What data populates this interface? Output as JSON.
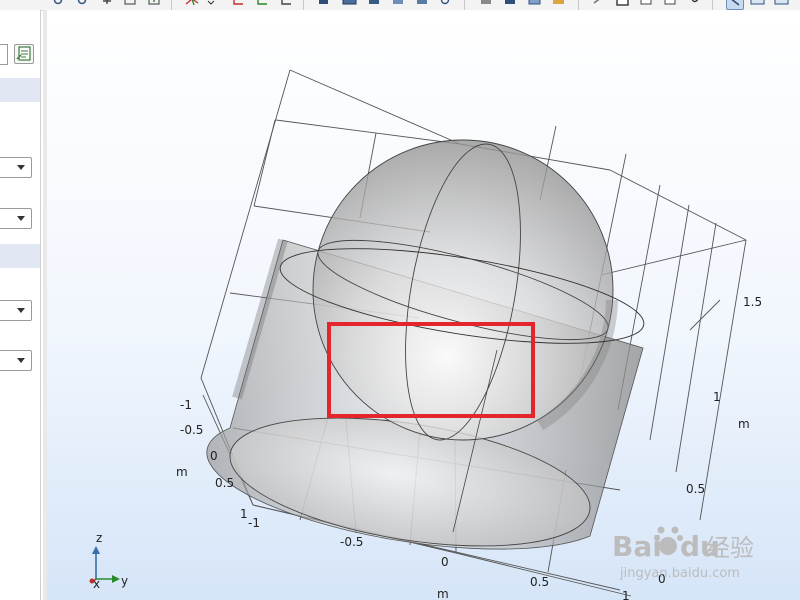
{
  "toolbar": {
    "icons": [
      "zoom-in-icon",
      "zoom-out-icon",
      "move-icon",
      "zoom-extents-icon",
      "axis-icon",
      "select-icon",
      "grid-icon",
      "view-icon",
      "block-icon",
      "wireframe-icon",
      "render-icon",
      "transparency-icon",
      "hide-icon",
      "show-icon",
      "light-icon",
      "camera-icon",
      "reset-view-icon",
      "rotate-icon",
      "print-icon",
      "snapshot-icon"
    ]
  },
  "left_panel": {
    "dropdowns": [
      {
        "value": ""
      },
      {
        "value": ""
      },
      {
        "value": ""
      },
      {
        "value": ""
      }
    ]
  },
  "axes": {
    "x_label": "m",
    "y_label": "m",
    "z_label": "m",
    "x_ticks": [
      "-1",
      "-0.5",
      "0",
      "0.5",
      "1"
    ],
    "y_ticks": [
      "-1",
      "-0.5",
      "0",
      "0.5",
      "1"
    ],
    "z_ticks": [
      "1.5",
      "1",
      "0.5",
      "0"
    ]
  },
  "triad": {
    "z": "z",
    "y": "y",
    "x": "x"
  },
  "highlight": {
    "color": "#e4262c"
  },
  "watermark": {
    "brand": "Bai",
    "brand2": "du",
    "suffix": "经验",
    "url": "jingyan.baidu.com"
  }
}
